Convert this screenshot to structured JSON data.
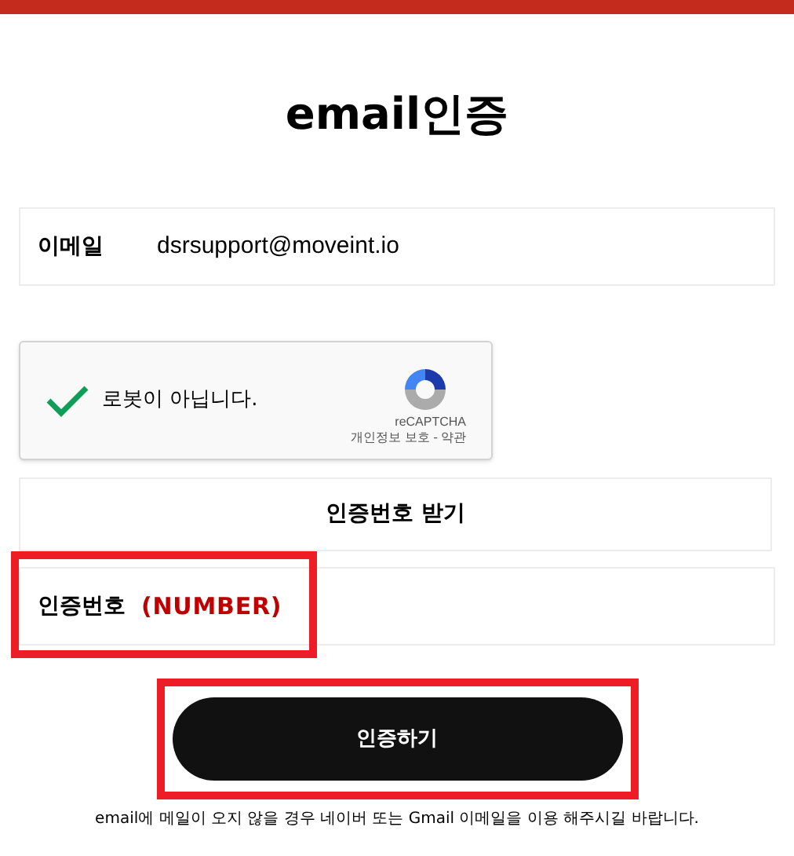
{
  "title": "email인증",
  "email_field": {
    "label": "이메일",
    "value": "dsrsupport@moveint.io"
  },
  "recaptcha": {
    "checked": true,
    "label": "로봇이 아닙니다.",
    "brand": "reCAPTCHA",
    "links": [
      "개인정보 보호",
      "약관"
    ],
    "separator": "-"
  },
  "send_code_button": {
    "label": "인증번호 받기"
  },
  "code_field": {
    "label": "인증번호",
    "annotation": "(NUMBER)",
    "highlighted": true
  },
  "submit_button": {
    "label": "인증하기",
    "highlighted": true
  },
  "notice": "email에 메일이 오지 않을 경우 네이버 또는 Gmail 이메일을 이용 해주시길 바랍니다."
}
